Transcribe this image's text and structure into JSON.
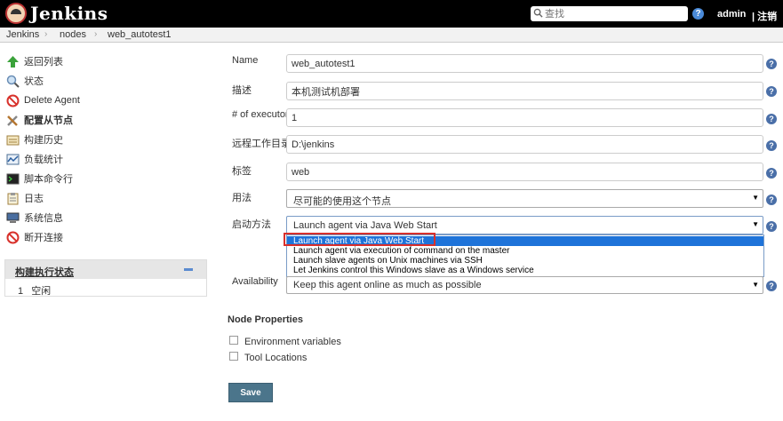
{
  "header": {
    "brand": "Jenkins",
    "search_placeholder": "查找",
    "help": "?",
    "user": "admin",
    "logout": "| 注销"
  },
  "breadcrumb": [
    "Jenkins",
    "nodes",
    "web_autotest1"
  ],
  "breadcrumb_sep": "›",
  "sidebar": {
    "items": [
      {
        "label": "返回列表",
        "icon": "up-arrow-icon"
      },
      {
        "label": "状态",
        "icon": "search-icon"
      },
      {
        "label": "Delete Agent",
        "icon": "no-entry-icon"
      },
      {
        "label": "配置从节点",
        "icon": "tools-icon"
      },
      {
        "label": "构建历史",
        "icon": "notepad-icon"
      },
      {
        "label": "负载统计",
        "icon": "graph-icon"
      },
      {
        "label": "脚本命令行",
        "icon": "terminal-icon"
      },
      {
        "label": "日志",
        "icon": "clipboard-icon"
      },
      {
        "label": "系统信息",
        "icon": "computer-icon"
      },
      {
        "label": "断开连接",
        "icon": "no-entry-icon"
      }
    ],
    "executor": {
      "title": "构建执行状态",
      "rows": [
        {
          "num": "1",
          "status": "空闲"
        }
      ]
    }
  },
  "form": {
    "name": {
      "label": "Name",
      "value": "web_autotest1"
    },
    "desc": {
      "label": "描述",
      "value": "本机测试机部署"
    },
    "executors": {
      "label": "# of executors",
      "value": "1"
    },
    "workdir": {
      "label": "远程工作目录",
      "value": "D:\\jenkins"
    },
    "tags": {
      "label": "标签",
      "value": "web"
    },
    "usage": {
      "label": "用法",
      "value": "尽可能的使用这个节点"
    },
    "launch": {
      "label": "启动方法",
      "value": "Launch agent via Java Web Start",
      "options": [
        "Launch agent via Java Web Start",
        "Launch agent via execution of command on the master",
        "Launch slave agents on Unix machines via SSH",
        "Let Jenkins control this Windows slave as a Windows service"
      ]
    },
    "availability": {
      "label": "Availability",
      "value": "Keep this agent online as much as possible"
    },
    "help": "?",
    "select_arrow": "▼"
  },
  "node_properties": {
    "title": "Node Properties",
    "options": [
      "Environment variables",
      "Tool Locations"
    ]
  },
  "save_label": "Save",
  "colors": {
    "header_bg": "#000000",
    "accent": "#1e73d9",
    "save_button": "#4b758b",
    "highlight_border": "#d9302c"
  }
}
